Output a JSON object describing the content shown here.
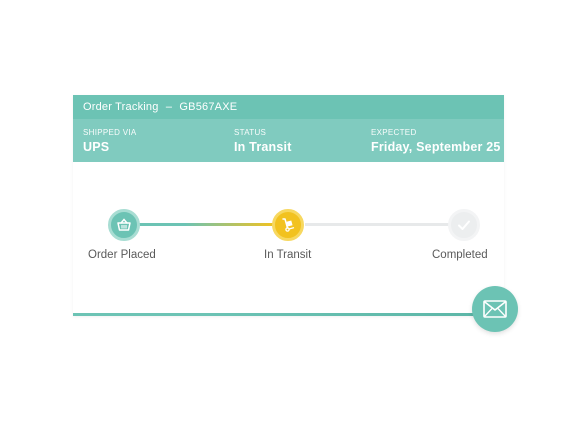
{
  "header": {
    "title": "Order Tracking",
    "separator": "–",
    "tracking_number": "GB567AXE"
  },
  "info": [
    {
      "label": "SHIPPED VIA",
      "value": "UPS"
    },
    {
      "label": "STATUS",
      "value": "In Transit"
    },
    {
      "label": "EXPECTED",
      "value": "Friday, September 25"
    }
  ],
  "steps": [
    {
      "label": "Order Placed",
      "icon": "basket-icon",
      "state": "done"
    },
    {
      "label": "In Transit",
      "icon": "hand-truck-icon",
      "state": "current"
    },
    {
      "label": "Completed",
      "icon": "checkmark-icon",
      "state": "pending"
    }
  ],
  "actions": {
    "mail_icon": "envelope-icon"
  },
  "colors": {
    "teal": "#6cc3b4",
    "teal_light": "#80cbbf",
    "yellow": "#f2c21f",
    "grey": "#e7e9ea",
    "text": "#5a5a5a"
  }
}
